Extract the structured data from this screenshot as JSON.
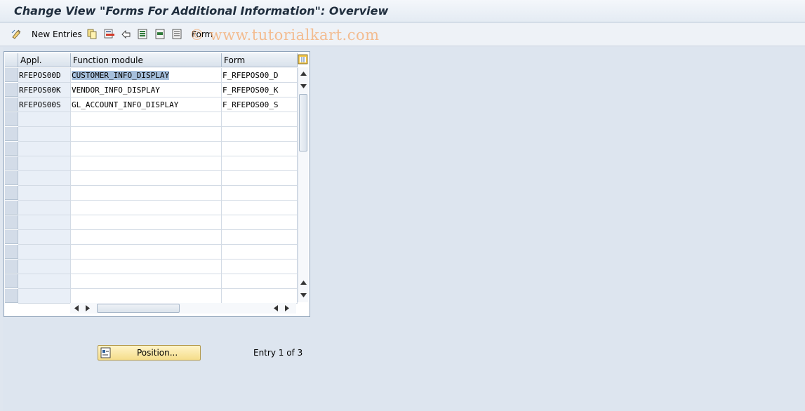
{
  "title": "Change View \"Forms For Additional Information\": Overview",
  "toolbar": {
    "new_entries_label": "New Entries",
    "form_label": "Form",
    "icons": [
      "change-display-icon",
      "copy-icon",
      "delete-icon",
      "undo-icon",
      "select-all-icon",
      "select-block-icon",
      "deselect-all-icon"
    ]
  },
  "watermark": "© www.tutorialkart.com",
  "table": {
    "headers": [
      "Appl.",
      "Function module",
      "Form"
    ],
    "rows": [
      [
        "RFEPOS00D",
        "CUSTOMER_INFO_DISPLAY",
        "F_RFEPOS00_D"
      ],
      [
        "RFEPOS00K",
        "VENDOR_INFO_DISPLAY",
        "F_RFEPOS00_K"
      ],
      [
        "RFEPOS00S",
        "GL_ACCOUNT_INFO_DISPLAY",
        "F_RFEPOS00_S"
      ]
    ],
    "empty_rows": 13
  },
  "position_button_label": "Position...",
  "entry_status": "Entry 1 of 3",
  "colors": {
    "background": "#dfe6ef",
    "selected_cell": "#a6bfdc",
    "position_button": "#f5dd8a",
    "watermark": "#f4aa6e"
  }
}
